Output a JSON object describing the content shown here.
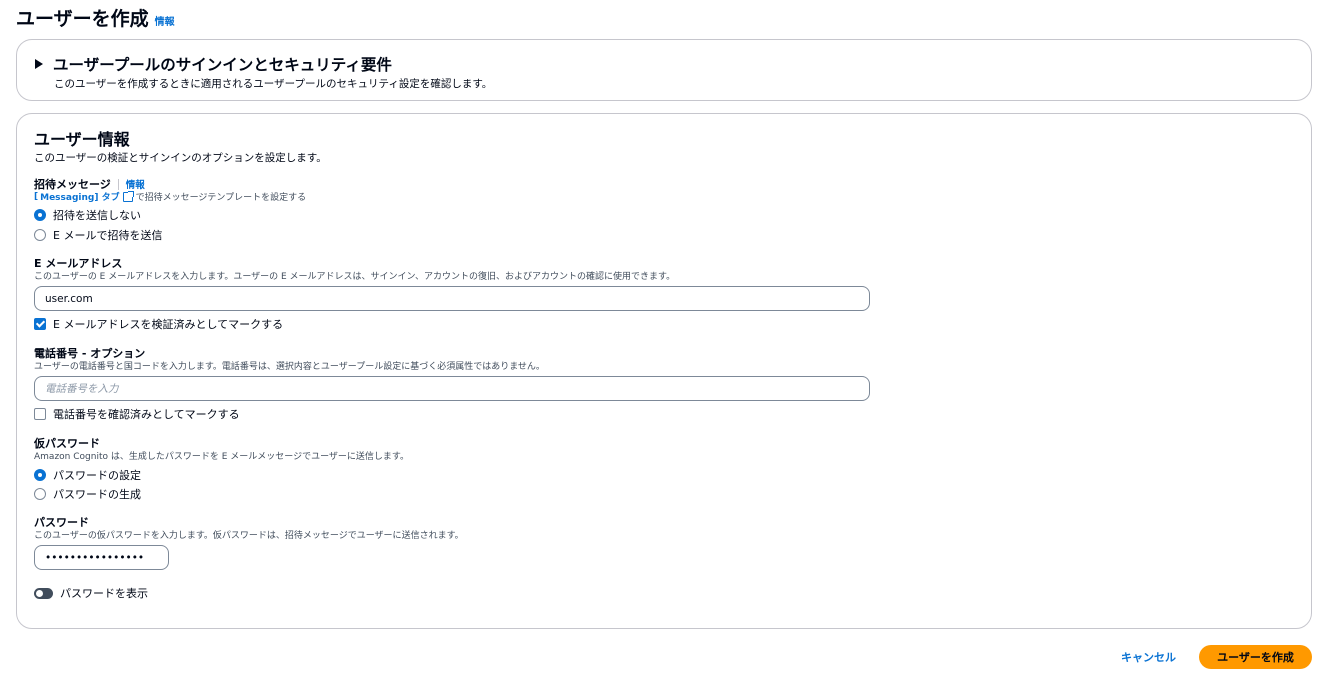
{
  "header": {
    "title": "ユーザーを作成",
    "info": "情報"
  },
  "security_panel": {
    "title": "ユーザープールのサインインとセキュリティ要件",
    "description": "このユーザーを作成するときに適用されるユーザープールのセキュリティ設定を確認します。",
    "expanded": false
  },
  "user_info": {
    "title": "ユーザー情報",
    "description": "このユーザーの検証とサインインのオプションを設定します。",
    "invitation": {
      "label": "招待メッセージ",
      "info": "情報",
      "hint_prefix": "[",
      "hint_link": "Messaging] タブ",
      "hint_suffix": "で招待メッセージテンプレートを設定する",
      "options": [
        {
          "label": "招待を送信しない",
          "selected": true
        },
        {
          "label": "E メールで招待を送信",
          "selected": false
        }
      ]
    },
    "email": {
      "label": "E メールアドレス",
      "hint": "このユーザーの E メールアドレスを入力します。ユーザーの E メールアドレスは、サインイン、アカウントの復旧、およびアカウントの確認に使用できます。",
      "value": "user.com",
      "verified_label": "E メールアドレスを検証済みとしてマークする",
      "verified": true
    },
    "phone": {
      "label": "電話番号 - オプション",
      "hint": "ユーザーの電話番号と国コードを入力します。電話番号は、選択内容とユーザープール設定に基づく必須属性ではありません。",
      "placeholder": "電話番号を入力",
      "value": "",
      "verified_label": "電話番号を確認済みとしてマークする",
      "verified": false
    },
    "temp_password": {
      "label": "仮パスワード",
      "hint": "Amazon Cognito は、生成したパスワードを E メールメッセージでユーザーに送信します。",
      "options": [
        {
          "label": "パスワードの設定",
          "selected": true
        },
        {
          "label": "パスワードの生成",
          "selected": false
        }
      ]
    },
    "password": {
      "label": "パスワード",
      "hint": "このユーザーの仮パスワードを入力します。仮パスワードは、招待メッセージでユーザーに送信されます。",
      "value": "••••••••••••••••",
      "show_label": "パスワードを表示",
      "show": false
    }
  },
  "actions": {
    "cancel": "キャンセル",
    "create": "ユーザーを作成"
  },
  "colors": {
    "accent": "#0972d3",
    "primary_button": "#ff9900",
    "border": "#c6c6cd"
  }
}
